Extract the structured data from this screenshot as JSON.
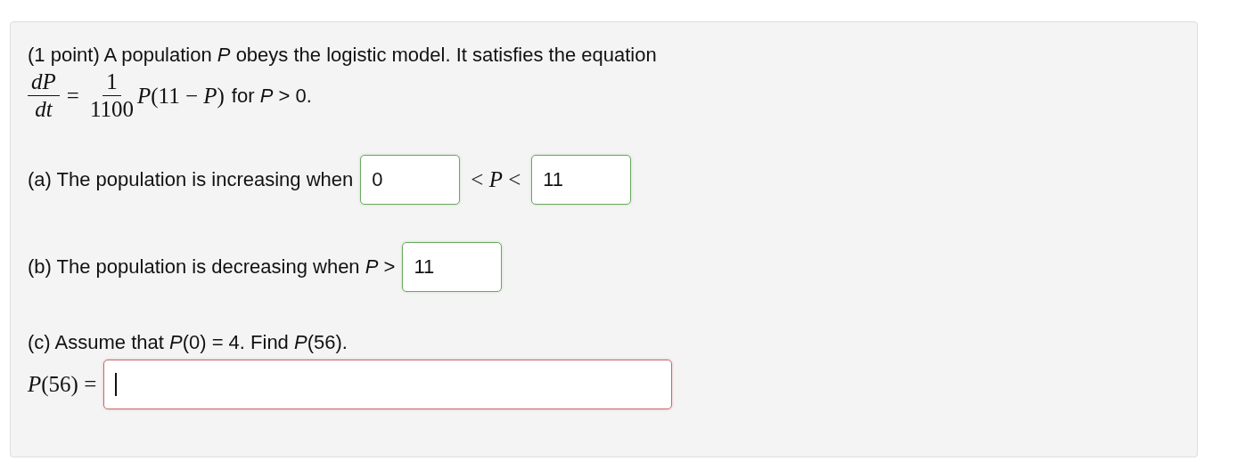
{
  "intro": "(1 point) A population *P* obeys the logistic model. It satisfies the equation",
  "equation": {
    "lhs_numerator": "dP",
    "lhs_denominator": "dt",
    "equals": "=",
    "rhs_numerator": "1",
    "rhs_denominator": "1100",
    "rhs_factor": "*P*(11 − *P*)",
    "condition": "for *P* > 0."
  },
  "part_a": {
    "prompt": "(a) The population is increasing when",
    "fields": [
      {
        "value": "0",
        "correct": true
      },
      {
        "value": "11",
        "correct": true
      }
    ],
    "between": "< *P* <"
  },
  "part_b": {
    "prompt": "(b) The population is decreasing when *P* >",
    "field": {
      "value": "11",
      "correct": true
    }
  },
  "part_c": {
    "prompt": "(c) Assume that *P*(0) = 4. Find *P*(56).",
    "label": "*P*(56) =",
    "field": {
      "correct": false,
      "focused": true
    }
  }
}
